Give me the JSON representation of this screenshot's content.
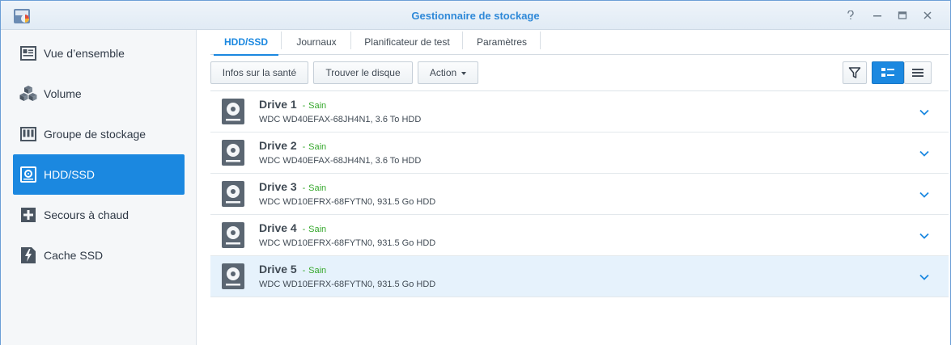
{
  "window": {
    "title": "Gestionnaire de stockage",
    "help_icon": "help-icon",
    "minimize_icon": "minimize-icon",
    "maximize_icon": "maximize-icon",
    "close_icon": "close-icon"
  },
  "sidebar": {
    "items": [
      {
        "label": "Vue d’ensemble",
        "icon": "overview-icon"
      },
      {
        "label": "Volume",
        "icon": "volume-cubes-icon"
      },
      {
        "label": "Groupe de stockage",
        "icon": "storage-pool-icon"
      },
      {
        "label": "HDD/SSD",
        "icon": "hdd-icon",
        "active": true
      },
      {
        "label": "Secours à chaud",
        "icon": "hot-spare-icon"
      },
      {
        "label": "Cache SSD",
        "icon": "ssd-cache-icon"
      }
    ]
  },
  "tabs": [
    {
      "label": "HDD/SSD",
      "active": true
    },
    {
      "label": "Journaux"
    },
    {
      "label": "Planificateur de test"
    },
    {
      "label": "Paramètres"
    }
  ],
  "toolbar": {
    "health_label": "Infos sur la santé",
    "locate_label": "Trouver le disque",
    "action_label": "Action",
    "filter_icon": "filter-icon",
    "detail_view_icon": "detail-view-icon",
    "list_view_icon": "list-view-icon"
  },
  "drives": [
    {
      "name": "Drive 1",
      "sep": "-",
      "status": "Sain",
      "model": "WDC WD40EFAX-68JH4N1, 3.6 To HDD"
    },
    {
      "name": "Drive 2",
      "sep": "-",
      "status": "Sain",
      "model": "WDC WD40EFAX-68JH4N1, 3.6 To HDD"
    },
    {
      "name": "Drive 3",
      "sep": "-",
      "status": "Sain",
      "model": "WDC WD10EFRX-68FYTN0, 931.5 Go HDD"
    },
    {
      "name": "Drive 4",
      "sep": "-",
      "status": "Sain",
      "model": "WDC WD10EFRX-68FYTN0, 931.5 Go HDD"
    },
    {
      "name": "Drive 5",
      "sep": "-",
      "status": "Sain",
      "model": "WDC WD10EFRX-68FYTN0, 931.5 Go HDD",
      "selected": true
    }
  ],
  "colors": {
    "accent": "#1b88e0",
    "healthy": "#36a82d",
    "selected_row": "#e6f2fc"
  }
}
